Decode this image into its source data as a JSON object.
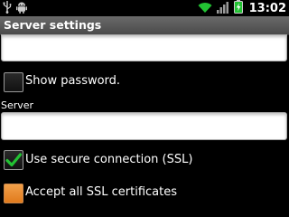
{
  "status_bar": {
    "time": "13:02",
    "icons_left": [
      "usb-icon",
      "android-icon"
    ],
    "icons_right": [
      "wifi-icon",
      "signal-icon",
      "battery-icon"
    ],
    "accent": "#22c233"
  },
  "title_bar": {
    "title": "Server settings"
  },
  "top_field": {
    "value": ""
  },
  "show_password": {
    "label": "Show password.",
    "checked": false
  },
  "server": {
    "label": "Server",
    "value": ""
  },
  "ssl": {
    "label": "Use secure connection (SSL)",
    "checked": true
  },
  "accept_ssl": {
    "label": "Accept all SSL certificates",
    "checked": false,
    "highlight_color": "#e8892e"
  }
}
